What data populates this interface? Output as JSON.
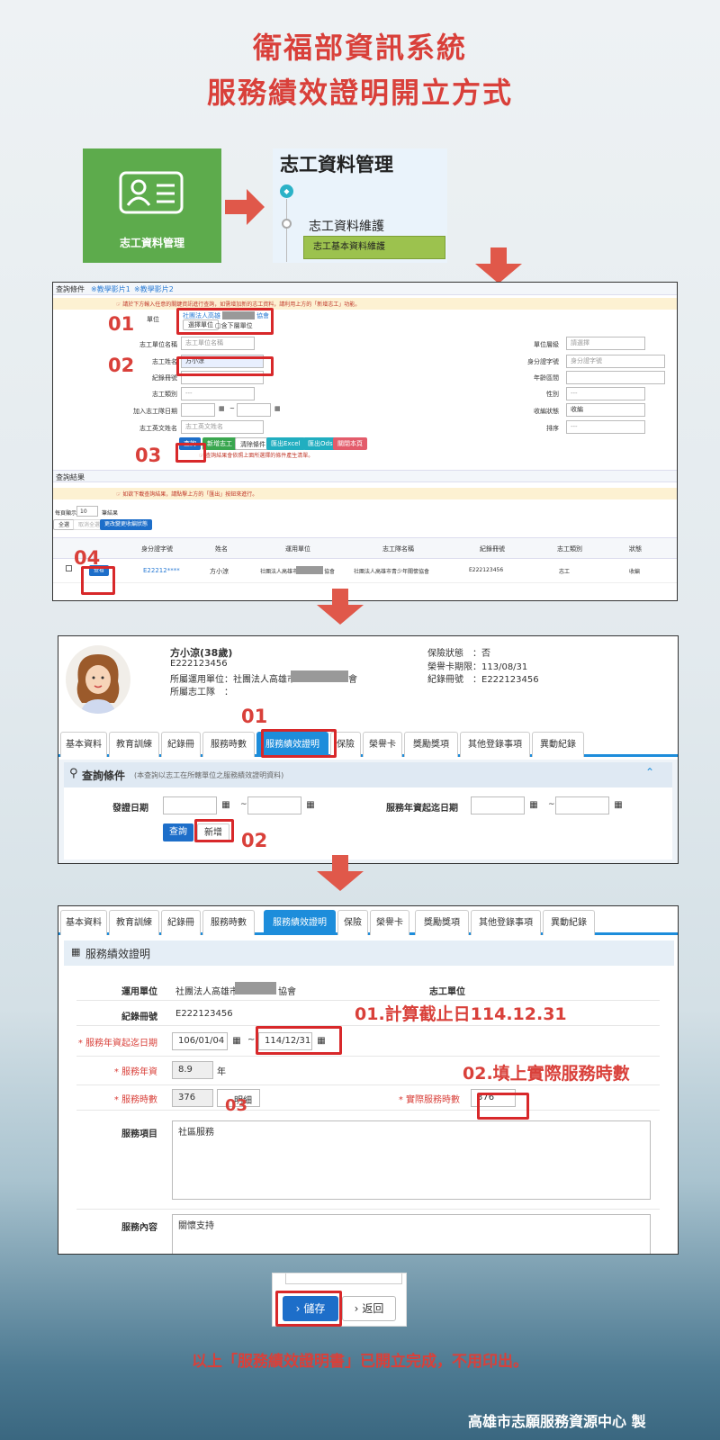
{
  "title": {
    "line1": "衛福部資訊系統",
    "line2": "服務績效證明開立方式"
  },
  "step1": {
    "card_label": "志工資料管理",
    "menu_title": "志工資料管理",
    "menu_item": "志工資料維護",
    "menu_sub": "志工基本資料維護"
  },
  "search": {
    "header": "查詢條件",
    "video1": "※教學影片1",
    "video2": "※教學影片2",
    "notice": "☞ 請於下方輸入任意的關鍵資訊進行查詢，如需增加新的志工資料，請利用上方的「新增志工」功能。",
    "unit_label": "單位",
    "unit_value": "社團法人高雄",
    "unit_suffix": "協會",
    "select_unit": "選擇單位",
    "include_sub": "▢含下層單位",
    "labels": [
      "志工單位名稱",
      "志工姓名",
      "紀錄冊號",
      "志工類別",
      "加入志工隊日期",
      "志工英文姓名"
    ],
    "placeholder_unitname": "志工單位名稱",
    "name_value": "方小涼",
    "placeholder_eng": "志工英文姓名",
    "select_dash": "---",
    "right_labels": [
      "單位層級",
      "身分證字號",
      "年齡區間",
      "性別",
      "收編狀態",
      "排序"
    ],
    "right_values": [
      "請選擇",
      "身分證字號",
      "",
      "---",
      "收編",
      "---"
    ],
    "buttons": [
      "查詢",
      "新增志工",
      "清除條件",
      "匯出Excel",
      "匯出Ods",
      "關閉本頁"
    ],
    "hint": "☞ 查詢結果會依照上面所選擇的條件產生清單。"
  },
  "results": {
    "header": "查詢結果",
    "notice": "☞ 如欲下載查詢結果，請點擊上方的「匯出」按鈕來進行。",
    "per_page_prefix": "每頁顯示",
    "per_page": "10",
    "per_page_suffix": "筆結果",
    "select_all": "全選",
    "cancel_all": "取消全選",
    "batch_btn": "更改變更收編狀態",
    "columns": [
      "身分證字號",
      "姓名",
      "運用單位",
      "志工隊名稱",
      "紀錄冊號",
      "志工類別",
      "狀態"
    ],
    "row": {
      "view": "查看",
      "id": "E22212****",
      "name": "方小涼",
      "unit": "社團法人高雄市",
      "unit_suffix": "協會",
      "team": "社團法人高雄市青少年關懷協會",
      "record": "E222123456",
      "type": "志工",
      "status": "收編"
    }
  },
  "profile": {
    "name": "方小涼(38歲)",
    "id": "E222123456",
    "unit": "所屬運用單位：社團法人高雄市",
    "unit_suffix": "會",
    "team": "所屬志工隊　：",
    "insurance": "保險狀態　：否",
    "card": "榮譽卡期限：113/08/31",
    "record": "紀錄冊號　：E222123456"
  },
  "tabs": [
    "基本資料",
    "教育訓練",
    "紀錄冊",
    "服務時數",
    "服務績效證明",
    "保險",
    "榮譽卡",
    "獎勵獎項",
    "其他登錄事項",
    "異動紀錄"
  ],
  "query": {
    "title": "查詢條件",
    "note": "(本查詢以志工在所轄單位之服務績效證明資料)",
    "issue_date": "發證日期",
    "period": "服務年資起迄日期",
    "tilde": "~",
    "search": "查詢",
    "add": "新增"
  },
  "form": {
    "title": "服務績效證明",
    "unit_label": "運用單位",
    "unit_value": "社團法人高雄市",
    "unit_suffix": "協會",
    "team_label": "志工單位",
    "record_label": "紀錄冊號",
    "record_value": "E222123456",
    "period_label": "* 服務年資起迄日期",
    "start": "106/01/04",
    "end": "114/12/31",
    "years_label": "* 服務年資",
    "years": "8.9",
    "years_unit": "年",
    "hours_label": "* 服務時數",
    "hours": "376",
    "detail": "明細",
    "actual_label": "* 實際服務時數",
    "actual": "376",
    "items_label": "服務項目",
    "items_value": "社區服務",
    "content_label": "服務內容",
    "content_value": "關懷支持"
  },
  "annotations": {
    "a01": "01",
    "a02": "02",
    "a03": "03",
    "a04": "04",
    "calc": "01.計算截止日114.12.31",
    "fill": "02.填上實際服務時數"
  },
  "save": {
    "save": "儲存",
    "back": "返回"
  },
  "footer": {
    "note": "以上「服務績效證明書」已開立完成，不用印出。",
    "credit": "高雄市志願服務資源中心 製"
  }
}
